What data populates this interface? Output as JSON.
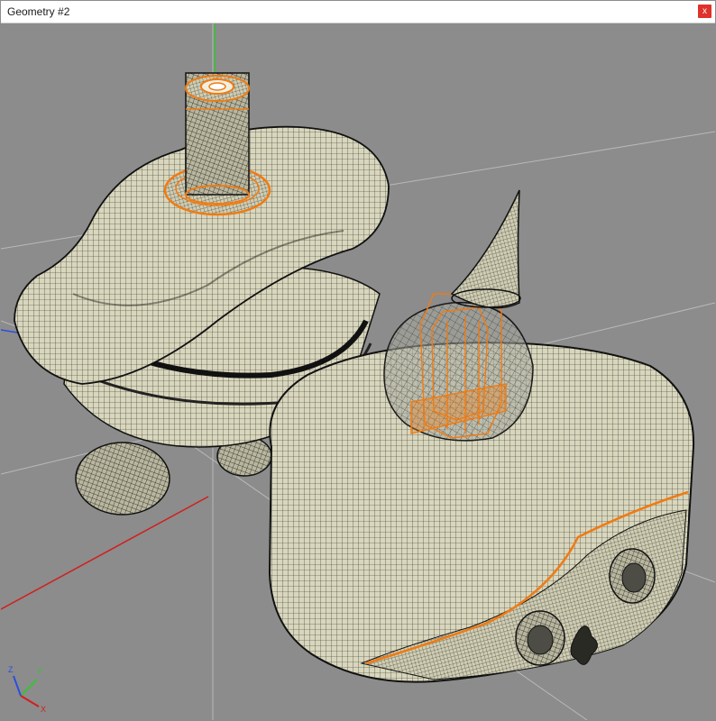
{
  "window": {
    "title": "Geometry #2",
    "close_glyph": "x"
  },
  "colors": {
    "viewport_bg": "#8c8c8c",
    "surface": "#d8d6bc",
    "mesh": "#1f1f1a",
    "feature_edge": "#f07b12",
    "grid_line": "#b9b9b9",
    "axis_x": "#d21e1e",
    "axis_y": "#35c335",
    "axis_z": "#2a4fe0"
  },
  "axis_labels": {
    "x": "X",
    "y": "Y",
    "z": "Z"
  },
  "icons": {
    "close": "close-icon",
    "triad": "axis-triad-icon"
  }
}
